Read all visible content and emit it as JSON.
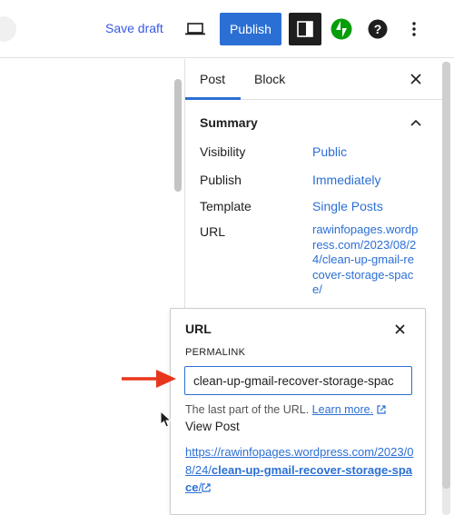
{
  "toolbar": {
    "save_draft": "Save draft",
    "publish": "Publish",
    "icons": [
      "preview-desktop-icon",
      "settings-sidebar-icon",
      "jetpack-icon",
      "help-icon",
      "more-options-icon"
    ],
    "accent": "#2b6fd4",
    "jetpack_color": "#069e08"
  },
  "sidebar": {
    "tabs": [
      {
        "label": "Post",
        "active": true
      },
      {
        "label": "Block",
        "active": false
      }
    ],
    "summary": {
      "title": "Summary",
      "rows": [
        {
          "label": "Visibility",
          "value": "Public"
        },
        {
          "label": "Publish",
          "value": "Immediately"
        },
        {
          "label": "Template",
          "value": "Single Posts"
        },
        {
          "label": "URL",
          "value": "rawinfopages.wordpress.com/2023/08/24/clean-up-gmail-recover-storage-space/"
        }
      ]
    }
  },
  "url_popover": {
    "title": "URL",
    "permalink_label": "PERMALINK",
    "permalink_value": "clean-up-gmail-recover-storage-spac",
    "help_text": "The last part of the URL.",
    "learn_more": "Learn more.",
    "view_post_label": "View Post",
    "post_link_prefix": "https://rawinfopages.wordpress.com/2023/08/24/",
    "post_link_slug": "clean-up-gmail-recover-storage-space",
    "post_link_suffix": "/"
  },
  "annotation": {
    "arrow_color": "#e8361c"
  }
}
